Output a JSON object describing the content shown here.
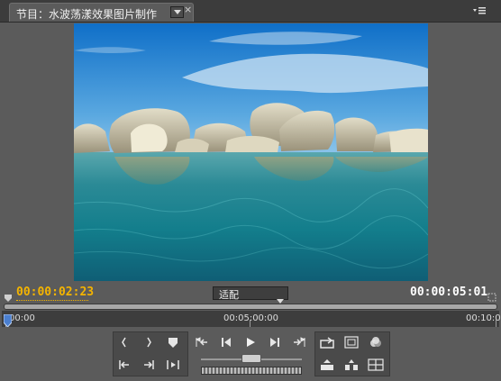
{
  "panel": {
    "tab_title": "节目：水波荡漾效果图片制作",
    "tab_dropdown_icon": "chevron-down-icon",
    "close_label": "×",
    "panel_menu_icon": "panel-menu-icon"
  },
  "timecode": {
    "current": "00:00:02:23",
    "duration": "00:00:05:01"
  },
  "view": {
    "fit_label": "适配"
  },
  "ruler": {
    "start": "00:00",
    "mid": "00:05:00:00",
    "end": "00:10:0"
  },
  "controls": {
    "left_group": [
      "mark-in-icon",
      "mark-out-icon",
      "set-marker-icon",
      "go-to-in-icon",
      "go-to-out-icon",
      "play-in-to-out-icon"
    ],
    "transport": [
      "go-to-previous-edit-icon",
      "step-back-icon",
      "play-icon",
      "step-forward-icon",
      "go-to-next-edit-icon"
    ],
    "right_group": [
      "loop-icon",
      "safe-margins-icon",
      "output-icon",
      "lift-icon",
      "extract-icon",
      "trim-icon"
    ]
  },
  "colors": {
    "timecode_current": "#f4b400",
    "timecode_duration": "#ffffff",
    "panel_bg": "#5b5b5b"
  }
}
